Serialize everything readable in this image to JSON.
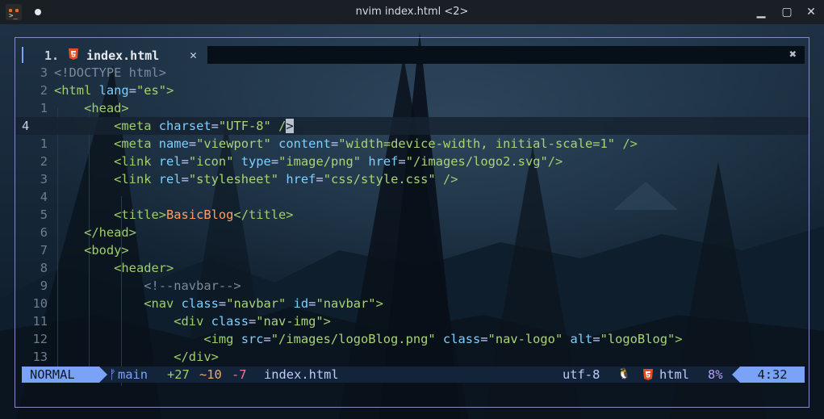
{
  "window": {
    "title": "nvim index.html <2>",
    "buttons": {
      "minimize": "▁",
      "maximize": "▢",
      "close": "✕"
    }
  },
  "tab": {
    "number": "1.",
    "filename": "index.html",
    "close": "✕",
    "fill_close": "✖"
  },
  "lines": [
    {
      "num": "3",
      "tokens": [
        [
          "c",
          "<!DOCTYPE html>"
        ]
      ]
    },
    {
      "num": "2",
      "tokens": [
        [
          "t",
          "<html"
        ],
        [
          "p",
          " "
        ],
        [
          "a",
          "lang"
        ],
        [
          "p",
          "="
        ],
        [
          "v",
          "\"es\""
        ],
        [
          "t",
          ">"
        ]
      ]
    },
    {
      "num": "1",
      "tokens": [
        [
          "p",
          "    "
        ],
        [
          "t",
          "<head>"
        ]
      ]
    },
    {
      "num": "4",
      "current": true,
      "tokens": [
        [
          "p",
          "        "
        ],
        [
          "t",
          "<meta"
        ],
        [
          "p",
          " "
        ],
        [
          "a",
          "charset"
        ],
        [
          "p",
          "="
        ],
        [
          "v",
          "\"UTF-8\""
        ],
        [
          "p",
          " "
        ],
        [
          "t",
          "/"
        ],
        [
          "cur",
          ">"
        ]
      ]
    },
    {
      "num": "1",
      "tokens": [
        [
          "p",
          "        "
        ],
        [
          "t",
          "<meta"
        ],
        [
          "p",
          " "
        ],
        [
          "a",
          "name"
        ],
        [
          "p",
          "="
        ],
        [
          "v",
          "\"viewport\""
        ],
        [
          "p",
          " "
        ],
        [
          "a",
          "content"
        ],
        [
          "p",
          "="
        ],
        [
          "v",
          "\"width=device-width, initial-scale=1\""
        ],
        [
          "p",
          " "
        ],
        [
          "t",
          "/>"
        ]
      ]
    },
    {
      "num": "2",
      "tokens": [
        [
          "p",
          "        "
        ],
        [
          "t",
          "<link"
        ],
        [
          "p",
          " "
        ],
        [
          "a",
          "rel"
        ],
        [
          "p",
          "="
        ],
        [
          "v",
          "\"icon\""
        ],
        [
          "p",
          " "
        ],
        [
          "a",
          "type"
        ],
        [
          "p",
          "="
        ],
        [
          "v",
          "\"image/png\""
        ],
        [
          "p",
          " "
        ],
        [
          "a",
          "href"
        ],
        [
          "p",
          "="
        ],
        [
          "v",
          "\"/images/logo2.svg\""
        ],
        [
          "t",
          "/>"
        ]
      ]
    },
    {
      "num": "3",
      "tokens": [
        [
          "p",
          "        "
        ],
        [
          "t",
          "<link"
        ],
        [
          "p",
          " "
        ],
        [
          "a",
          "rel"
        ],
        [
          "p",
          "="
        ],
        [
          "v",
          "\"stylesheet\""
        ],
        [
          "p",
          " "
        ],
        [
          "a",
          "href"
        ],
        [
          "p",
          "="
        ],
        [
          "v",
          "\"css/style.css\""
        ],
        [
          "p",
          " "
        ],
        [
          "t",
          "/>"
        ]
      ]
    },
    {
      "num": "4",
      "tokens": []
    },
    {
      "num": "5",
      "tokens": [
        [
          "p",
          "        "
        ],
        [
          "t",
          "<title>"
        ],
        [
          "x",
          "BasicBlog"
        ],
        [
          "t",
          "</title>"
        ]
      ]
    },
    {
      "num": "6",
      "tokens": [
        [
          "p",
          "    "
        ],
        [
          "t",
          "</head>"
        ]
      ]
    },
    {
      "num": "7",
      "tokens": [
        [
          "p",
          "    "
        ],
        [
          "t",
          "<body>"
        ]
      ]
    },
    {
      "num": "8",
      "tokens": [
        [
          "p",
          "        "
        ],
        [
          "t",
          "<header>"
        ]
      ]
    },
    {
      "num": "9",
      "tokens": [
        [
          "p",
          "            "
        ],
        [
          "c",
          "<!--navbar-->"
        ]
      ]
    },
    {
      "num": "10",
      "tokens": [
        [
          "p",
          "            "
        ],
        [
          "t",
          "<nav"
        ],
        [
          "p",
          " "
        ],
        [
          "a",
          "class"
        ],
        [
          "p",
          "="
        ],
        [
          "v",
          "\"navbar\""
        ],
        [
          "p",
          " "
        ],
        [
          "a",
          "id"
        ],
        [
          "p",
          "="
        ],
        [
          "v",
          "\"navbar\""
        ],
        [
          "t",
          ">"
        ]
      ]
    },
    {
      "num": "11",
      "tokens": [
        [
          "p",
          "                "
        ],
        [
          "t",
          "<div"
        ],
        [
          "p",
          " "
        ],
        [
          "a",
          "class"
        ],
        [
          "p",
          "="
        ],
        [
          "v",
          "\"nav-img\""
        ],
        [
          "t",
          ">"
        ]
      ]
    },
    {
      "num": "12",
      "tokens": [
        [
          "p",
          "                    "
        ],
        [
          "t",
          "<img"
        ],
        [
          "p",
          " "
        ],
        [
          "a",
          "src"
        ],
        [
          "p",
          "="
        ],
        [
          "v",
          "\"/images/logoBlog.png\""
        ],
        [
          "p",
          " "
        ],
        [
          "a",
          "class"
        ],
        [
          "p",
          "="
        ],
        [
          "v",
          "\"nav-logo\""
        ],
        [
          "p",
          " "
        ],
        [
          "a",
          "alt"
        ],
        [
          "p",
          "="
        ],
        [
          "v",
          "\"logoBlog\""
        ],
        [
          "t",
          ">"
        ]
      ]
    },
    {
      "num": "13",
      "tokens": [
        [
          "p",
          "                "
        ],
        [
          "t",
          "</div>"
        ]
      ]
    }
  ],
  "statusline": {
    "mode": "NORMAL",
    "branch_icon": "ᚠ",
    "branch": "main",
    "added": "+27",
    "changed": "~10",
    "removed": "-7",
    "filename": "index.html",
    "encoding": "utf-8",
    "os_icon": "🐧",
    "filetype": "html",
    "percent": "8%",
    "position": "4:32"
  },
  "colors": {
    "accent": "#7aa2f7",
    "tag": "#9ece6a",
    "attribute": "#7dcfff",
    "string": "#a8d377",
    "comment": "#7c8a9c",
    "title_text": "#ff9e64",
    "added": "#9ece6a",
    "changed": "#e0af68",
    "removed": "#f7768e",
    "html_icon": "#e44d26",
    "frame_border": "#8f88c0"
  }
}
